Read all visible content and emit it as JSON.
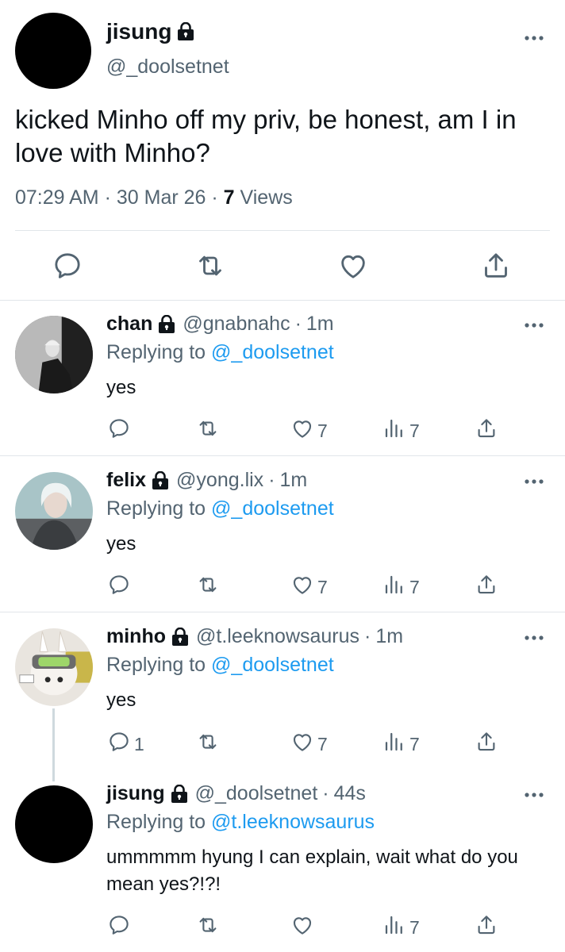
{
  "main_tweet": {
    "name": "jisung",
    "handle": "@_doolsetnet",
    "text": "kicked Minho off my priv, be honest, am I in love with Minho?",
    "time": "07:29 AM",
    "date": "30 Mar 26",
    "views_count": "7",
    "views_label": "Views",
    "separator": "·",
    "actions": [
      "reply-icon",
      "retweet-icon",
      "like-icon",
      "share-icon"
    ]
  },
  "replies": [
    {
      "name": "chan",
      "handle": "@gnabnahc",
      "time": "1m",
      "replying_label": "Replying to",
      "replying_to": "@_doolsetnet",
      "text": "yes",
      "reply_count": "",
      "like_count": "7",
      "view_count": "7"
    },
    {
      "name": "felix",
      "handle": "@yong.lix",
      "time": "1m",
      "replying_label": "Replying to",
      "replying_to": "@_doolsetnet",
      "text": "yes",
      "reply_count": "",
      "like_count": "7",
      "view_count": "7"
    },
    {
      "name": "minho",
      "handle": "@t.leeknowsaurus",
      "time": "1m",
      "replying_label": "Replying to",
      "replying_to": "@_doolsetnet",
      "text": "yes",
      "reply_count": "1",
      "like_count": "7",
      "view_count": "7"
    },
    {
      "name": "jisung",
      "handle": "@_doolsetnet",
      "time": "44s",
      "replying_label": "Replying to",
      "replying_to": "@t.leeknowsaurus",
      "text": "ummmmm hyung I can explain, wait what do you mean yes?!?!",
      "reply_count": "",
      "like_count": "",
      "view_count": "7"
    }
  ],
  "colors": {
    "text": "#0f1419",
    "secondary": "#536471",
    "link": "#1d9bf0",
    "divider": "#e1e6ea"
  }
}
